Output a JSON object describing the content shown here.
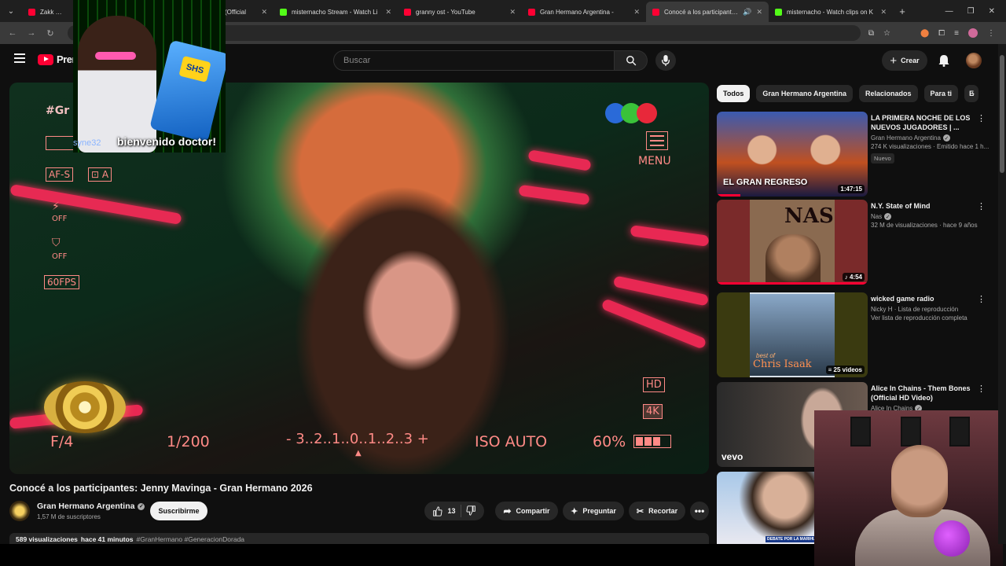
{
  "browser": {
    "tabs": [
      {
        "title": "Zakk Sabbath",
        "favicon": "youtube-icon",
        "active": false
      },
      {
        "title": "(Official",
        "favicon": "none",
        "active": false
      },
      {
        "title": "misternacho Stream - Watch Li",
        "favicon": "kick-icon",
        "active": false
      },
      {
        "title": "granny ost - YouTube",
        "favicon": "youtube-icon",
        "active": false
      },
      {
        "title": "Gran Hermano Argentina -",
        "favicon": "youtube-icon",
        "active": false
      },
      {
        "title": "Conocé a los participantes",
        "favicon": "youtube-icon",
        "active": true
      },
      {
        "title": "misternacho - Watch clips on K",
        "favicon": "kick-icon",
        "active": false
      }
    ]
  },
  "header": {
    "logo_text": "Prem",
    "search_placeholder": "Buscar",
    "create_label": "Crear"
  },
  "player": {
    "osd": {
      "hashtag": "#Gr",
      "af_mode": "AF-S",
      "metering": "A",
      "off1": "OFF",
      "off2": "OFF",
      "fps": "60FPS",
      "menu": "MENU",
      "hd": "HD",
      "res4k": "4K",
      "aperture": "F/4",
      "shutter": "1/200",
      "exposure": "- 3..2..1..0..1..2..3 +",
      "iso": "ISO AUTO",
      "battery": "60%"
    },
    "tv_logo_colors": [
      "#2a6ad8",
      "#3ac23a",
      "#e8283a"
    ]
  },
  "overlay": {
    "meme_badge": "SHS",
    "meme_caption": "bienvenido doctor!",
    "meme_caption_tag": "syne32"
  },
  "video": {
    "title": "Conocé a los participantes: Jenny Mavinga - Gran Hermano 2026",
    "channel": "Gran Hermano Argentina",
    "subscribers": "1,57 M de suscriptores",
    "subscribe_label": "Suscribirme",
    "likes": "13",
    "share_label": "Compartir",
    "ask_label": "Preguntar",
    "clip_label": "Recortar",
    "views": "589 visualizaciones",
    "age": "hace 41 minutos",
    "hashtags": "#GranHermano #GeneracionDorada"
  },
  "sidebar": {
    "chips": [
      "Todos",
      "Gran Hermano Argentina",
      "Relacionados",
      "Para ti",
      "E"
    ],
    "recommendations": [
      {
        "title": "LA PRIMERA NOCHE DE LOS NUEVOS JUGADORES | ...",
        "channel": "Gran Hermano Argentina",
        "stats": "274 K visualizaciones · Emitido hace 1 h...",
        "badge": "Nuevo",
        "duration": "1:47:15",
        "thumb_text": "EL GRAN REGRESO"
      },
      {
        "title": "N.Y. State of Mind",
        "channel": "Nas",
        "stats": "32 M de visualizaciones · hace 9 años",
        "duration": "4:54",
        "thumb_text": "NAS"
      },
      {
        "title": "wicked game radio",
        "channel": "Nicky H · Lista de reproducción",
        "stats": "Ver lista de reproducción completa",
        "duration": "25 videos",
        "thumb_text": "Chris Isaak",
        "thumb_sub": "best of"
      },
      {
        "title": "Alice In Chains - Them Bones (Official HD Video)",
        "channel": "Alice In Chains",
        "stats": "",
        "duration": "",
        "thumb_text": "vevo"
      },
      {
        "title": "",
        "channel": "",
        "stats": "",
        "duration": "",
        "thumb_text": "DEBATE POR LA MARIHUANA"
      }
    ]
  },
  "colors": {
    "youtube_red": "#ff0033",
    "kick_green": "#53fc18",
    "osd_pink": "#ff8a86"
  }
}
